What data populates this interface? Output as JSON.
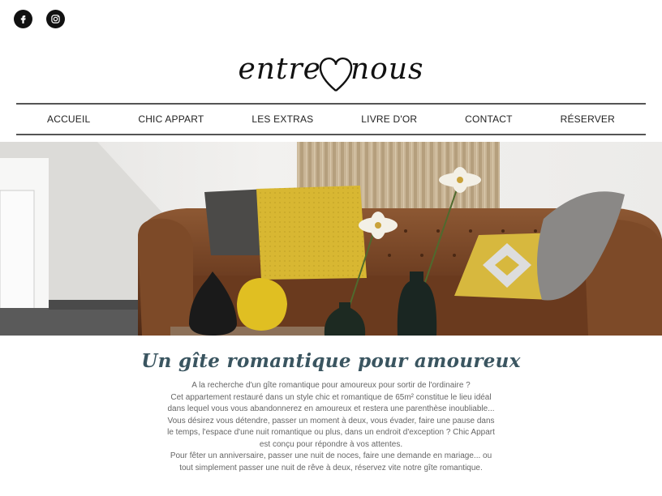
{
  "social": {
    "facebook_icon": "facebook-icon",
    "instagram_icon": "instagram-icon"
  },
  "logo": {
    "left_text": "entre",
    "right_text": "nous",
    "heart_icon": "heart-icon"
  },
  "nav": {
    "items": [
      {
        "label": "ACCUEIL"
      },
      {
        "label": "CHIC APPART"
      },
      {
        "label": "LES EXTRAS"
      },
      {
        "label": "LIVRE D'OR"
      },
      {
        "label": "CONTACT"
      },
      {
        "label": "RÉSERVER"
      }
    ]
  },
  "content": {
    "headline": "Un gîte romantique pour amoureux",
    "lines": [
      "A la recherche d'un gîte romantique pour amoureux pour sortir de l'ordinaire ?",
      "Cet appartement restauré dans un style chic et romantique de 65m² constitue le lieu idéal dans lequel vous vous abandonnerez en amoureux et restera une parenthèse inoubliable...",
      "Vous désirez vous détendre, passer un moment à deux, vous évader, faire une pause dans le temps, l'espace d'une nuit romantique ou plus, dans un endroit d'exception ? Chic Appart est conçu pour répondre à vos attentes.",
      "Pour fêter un anniversaire, passer une nuit de noces, faire une demande en mariage... ou tout simplement passer une nuit de rêve à deux, réservez vite notre gîte romantique."
    ]
  },
  "colors": {
    "headline": "#3a5560",
    "nav_border": "#555555",
    "sofa": "#7a4a2a",
    "cushion_yellow": "#d9b838"
  }
}
